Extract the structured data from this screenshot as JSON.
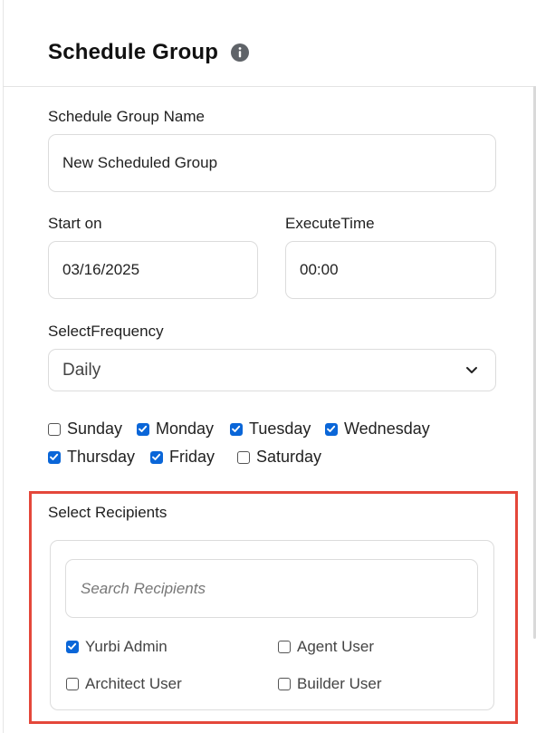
{
  "header": {
    "title": "Schedule Group"
  },
  "form": {
    "name_label": "Schedule Group Name",
    "name_value": "New Scheduled Group",
    "start_label": "Start on",
    "start_value": "03/16/2025",
    "time_label": "ExecuteTime",
    "time_value": "00:00",
    "frequency_label": "SelectFrequency",
    "frequency_value": "Daily"
  },
  "days": [
    {
      "label": "Sunday",
      "checked": false
    },
    {
      "label": "Monday",
      "checked": true
    },
    {
      "label": "Tuesday",
      "checked": true
    },
    {
      "label": "Wednesday",
      "checked": true
    },
    {
      "label": "Thursday",
      "checked": true
    },
    {
      "label": "Friday",
      "checked": true
    },
    {
      "label": "Saturday",
      "checked": false
    }
  ],
  "recipients": {
    "label": "Select Recipients",
    "search_placeholder": "Search Recipients",
    "items": [
      {
        "label": "Yurbi Admin",
        "checked": true
      },
      {
        "label": "Agent User",
        "checked": false
      },
      {
        "label": "Architect User",
        "checked": false
      },
      {
        "label": "Builder User",
        "checked": false
      }
    ]
  },
  "colors": {
    "accent": "#0a66d8",
    "highlight": "#e4473a",
    "border": "#dcdcdc"
  }
}
